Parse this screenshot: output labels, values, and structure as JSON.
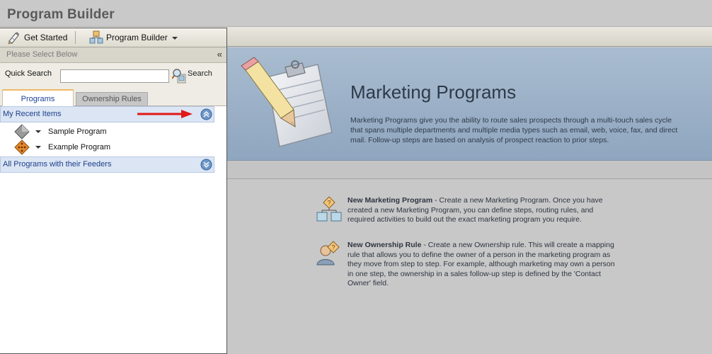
{
  "app": {
    "title": "Program Builder"
  },
  "toolbar": {
    "get_started": "Get Started",
    "program_builder": "Program Builder"
  },
  "panel": {
    "select_label": "Please Select Below",
    "collapse": "«",
    "search": {
      "label": "Quick Search",
      "value": "",
      "placeholder": "",
      "button": "Search"
    },
    "tabs": [
      {
        "label": "Programs",
        "active": true
      },
      {
        "label": "Ownership Rules",
        "active": false
      }
    ],
    "recent": {
      "header": "My Recent Items",
      "items": [
        {
          "label": "Sample Program",
          "icon": "grey-diamond-icon"
        },
        {
          "label": "Example Program",
          "icon": "orange-diamond-icon"
        }
      ]
    },
    "all_programs": {
      "header": "All Programs with their Feeders"
    }
  },
  "hero": {
    "title": "Marketing Programs",
    "description": "Marketing Programs give you the ability to route sales prospects through a multi-touch sales cycle that spans multiple departments and multiple media types such as email, web, voice, fax, and direct mail. Follow-up steps are based on analysis of prospect reaction to prior steps."
  },
  "actions": [
    {
      "title": "New Marketing Program",
      "text": " - Create a new Marketing Program. Once you have created a new Marketing Program, you can define steps, routing rules, and required activities to build out the exact marketing program you require."
    },
    {
      "title": "New Ownership Rule",
      "text": " - Create a new Ownership rule. This will create a mapping rule that allows you to define the owner of a person in the marketing program as they move from step to step. For example, although marketing may own a person in one step, the ownership in a sales follow-up step is defined by the 'Contact Owner' field."
    }
  ],
  "colors": {
    "hero_bg": "#a9bcd0",
    "section_header_bg": "#dbe5f4",
    "tab_accent": "#f1b865",
    "arrow": "#e01818"
  }
}
